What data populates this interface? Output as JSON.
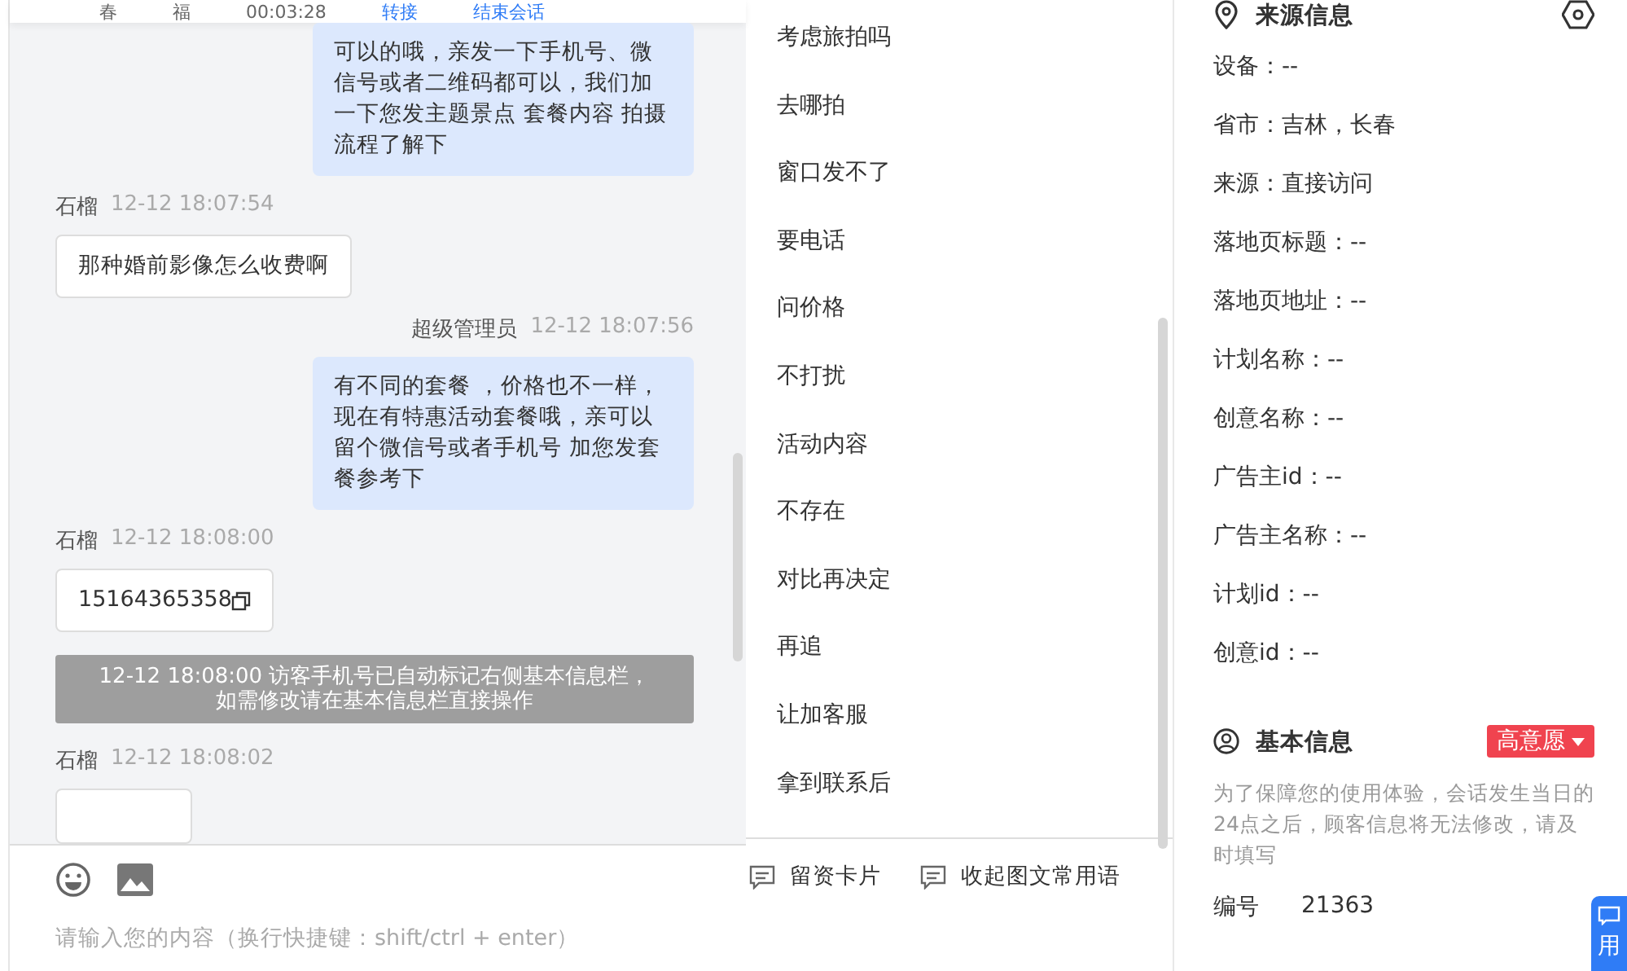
{
  "header": {
    "items": [
      "春",
      "福",
      "00:03:28"
    ],
    "actions": [
      "转接",
      "结束会话"
    ]
  },
  "messages": [
    {
      "kind": "agent",
      "text": "可以的哦，亲发一下手机号、微信号或者二维码都可以，我们加一下您发主题景点 套餐内容 拍摄流程了解下"
    },
    {
      "kind": "visitor",
      "name": "石榴",
      "time": "12-12 18:07:54",
      "text": "那种婚前影像怎么收费啊"
    },
    {
      "kind": "agent",
      "name": "超级管理员",
      "time": "12-12 18:07:56",
      "text": "有不同的套餐 ，价格也不一样，现在有特惠活动套餐哦，亲可以留个微信号或者手机号 加您发套餐参考下"
    },
    {
      "kind": "phone",
      "name": "石榴",
      "time": "12-12 18:08:00",
      "text": "15164365358"
    },
    {
      "kind": "system",
      "text": "12-12 18:08:00 访客手机号已自动标记右侧基本信息栏，如需修改请在基本信息栏直接操作"
    },
    {
      "kind": "stub",
      "name": "石榴",
      "time": "12-12 18:08:02"
    }
  ],
  "input": {
    "placeholder": "请输入您的内容（换行快捷键：shift/ctrl + enter）"
  },
  "quick_replies": [
    "考虑旅拍吗",
    "去哪拍",
    "窗口发不了",
    "要电话",
    "问价格",
    "不打扰",
    "活动内容",
    "不存在",
    "对比再决定",
    "再追",
    "让加客服",
    "拿到联系后"
  ],
  "quick_actions": [
    "留资卡片",
    "收起图文常用语"
  ],
  "source_info": {
    "title": "来源信息",
    "rows": [
      "设备：--",
      "省市：吉林，长春",
      "来源：直接访问",
      "落地页标题：--",
      "落地页地址：--",
      "计划名称：--",
      "创意名称：--",
      "广告主id：--",
      "广告主名称：--",
      "计划id：--",
      "创意id：--"
    ]
  },
  "basic_info": {
    "title": "基本信息",
    "tag": "高意愿",
    "note": "为了保障您的使用体验，会话发生当日的24点之后，顾客信息将无法修改，请及时填写",
    "fields": [
      {
        "label": "编号",
        "value": "21363"
      }
    ]
  },
  "float_button": {
    "label": "用"
  }
}
